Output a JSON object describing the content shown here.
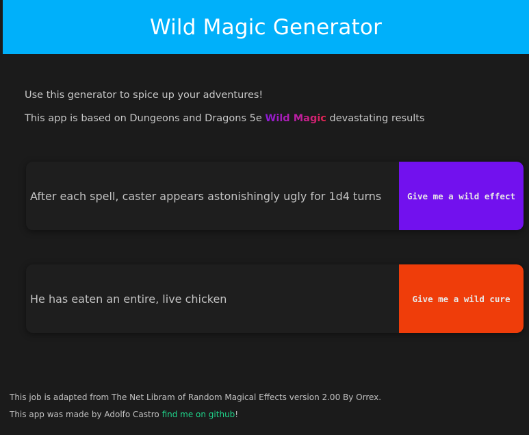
{
  "header": {
    "title": "Wild Magic Generator"
  },
  "intro": {
    "line1": "Use this generator to spice up your adventures!",
    "line2_before": "This app is based on Dungeons and Dragons 5e ",
    "line2_highlight": "Wild Magic",
    "line2_after": " devastating results"
  },
  "effect_card": {
    "result": "After each spell, caster appears astonishingly ugly for 1d4 turns",
    "button_label": "Give me a wild effect",
    "button_color": "#7211ee"
  },
  "cure_card": {
    "result": "He has eaten an entire, live chicken",
    "button_label": "Give me a wild cure",
    "button_color": "#ef3d0a"
  },
  "footer": {
    "credit": "This job is adapted from The Net Libram of Random Magical Effects version 2.00 By Orrex.",
    "author_before": "This app was made by Adolfo Castro ",
    "author_link": "find me on github",
    "author_after": "!"
  },
  "colors": {
    "header_bg": "#00b0fa",
    "page_bg": "#1b1b1b",
    "link": "#1fd38a"
  }
}
